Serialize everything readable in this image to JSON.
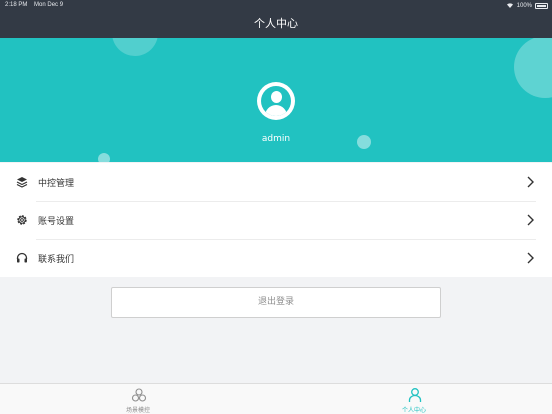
{
  "status_bar": {
    "time": "2:18 PM",
    "date": "Mon Dec 9",
    "battery": "100%"
  },
  "nav": {
    "title": "个人中心"
  },
  "profile": {
    "username": "admin",
    "avatar_icon": "user-avatar-icon"
  },
  "menu": {
    "items": [
      {
        "label": "中控管理",
        "icon": "layers-icon"
      },
      {
        "label": "账号设置",
        "icon": "gear-icon"
      },
      {
        "label": "联系我们",
        "icon": "headset-icon"
      }
    ]
  },
  "logout": {
    "label": "退出登录"
  },
  "tabs": [
    {
      "label": "场景模控",
      "icon": "scenes-icon",
      "active": false
    },
    {
      "label": "个人中心",
      "icon": "person-icon",
      "active": true
    }
  ],
  "colors": {
    "accent": "#21c2c1",
    "nav_bg": "#333a45",
    "background": "#f2f3f5"
  }
}
